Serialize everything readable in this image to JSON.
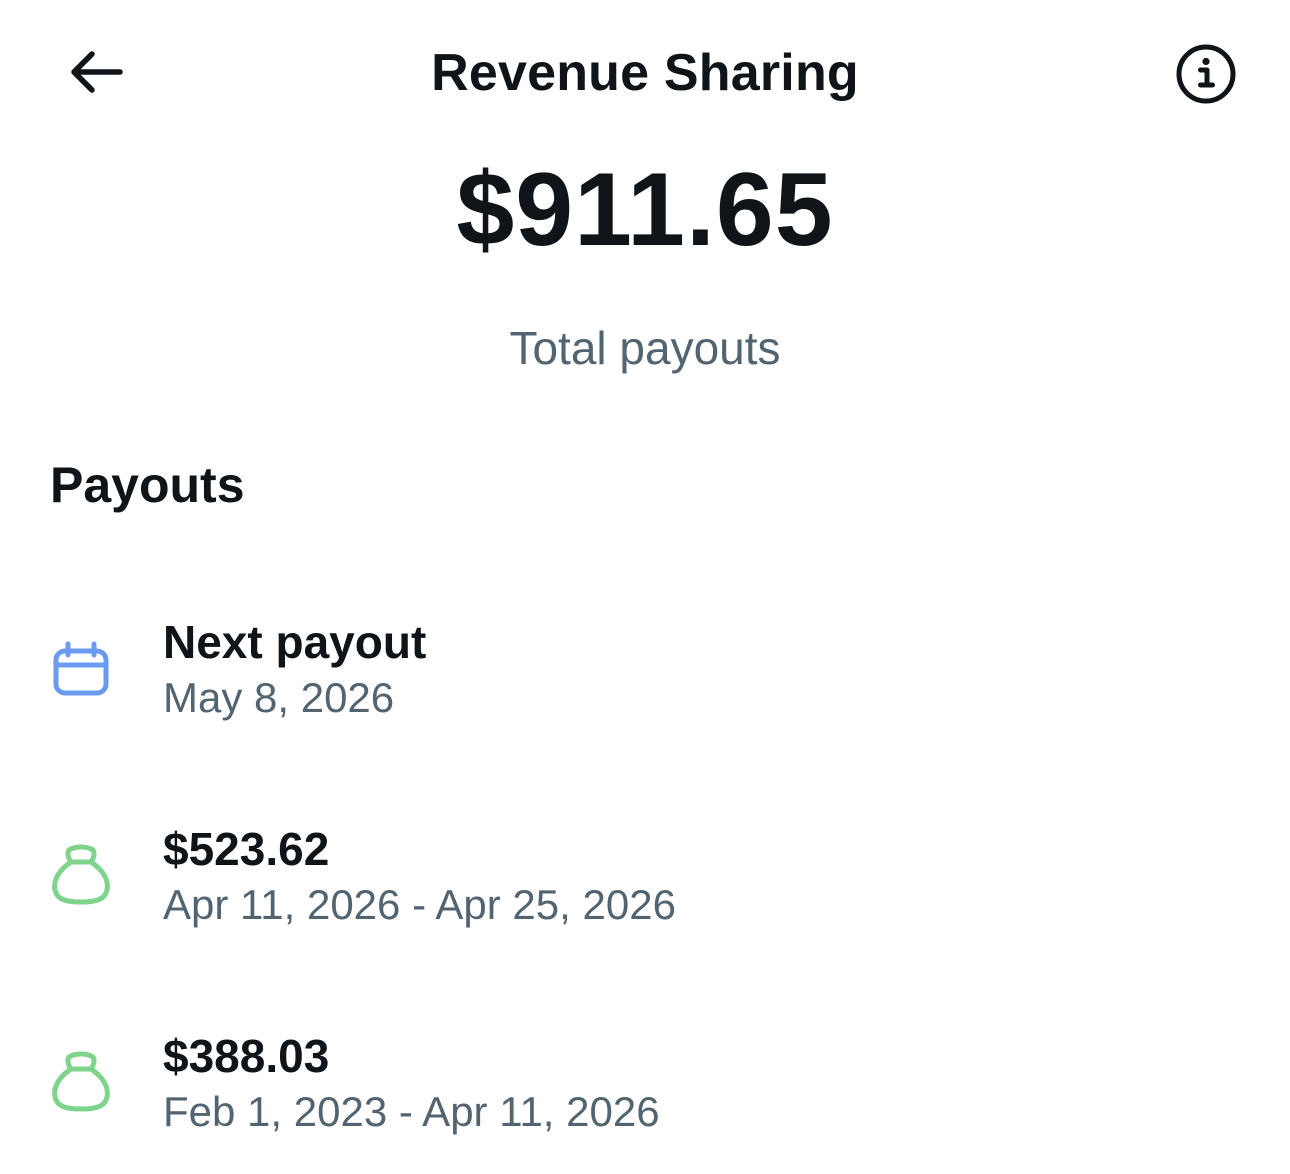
{
  "header": {
    "title": "Revenue Sharing",
    "back_icon": "arrow-left-icon",
    "info_icon": "info-circle-icon"
  },
  "summary": {
    "total_amount": "$911.65",
    "total_label": "Total payouts"
  },
  "payouts": {
    "heading": "Payouts",
    "items": [
      {
        "icon": "calendar-icon",
        "icon_color": "#6b9bf0",
        "title": "Next payout",
        "subtitle": "May 8, 2026"
      },
      {
        "icon": "money-bag-icon",
        "icon_color": "#7fd48c",
        "title": "$523.62",
        "subtitle": "Apr 11, 2026 - Apr 25, 2026"
      },
      {
        "icon": "money-bag-icon",
        "icon_color": "#7fd48c",
        "title": "$388.03",
        "subtitle": "Feb 1, 2023 - Apr 11, 2026"
      }
    ]
  },
  "colors": {
    "text_primary": "#0f1419",
    "text_secondary": "#536471",
    "calendar_blue": "#6b9bf0",
    "money_green": "#7fd48c"
  }
}
